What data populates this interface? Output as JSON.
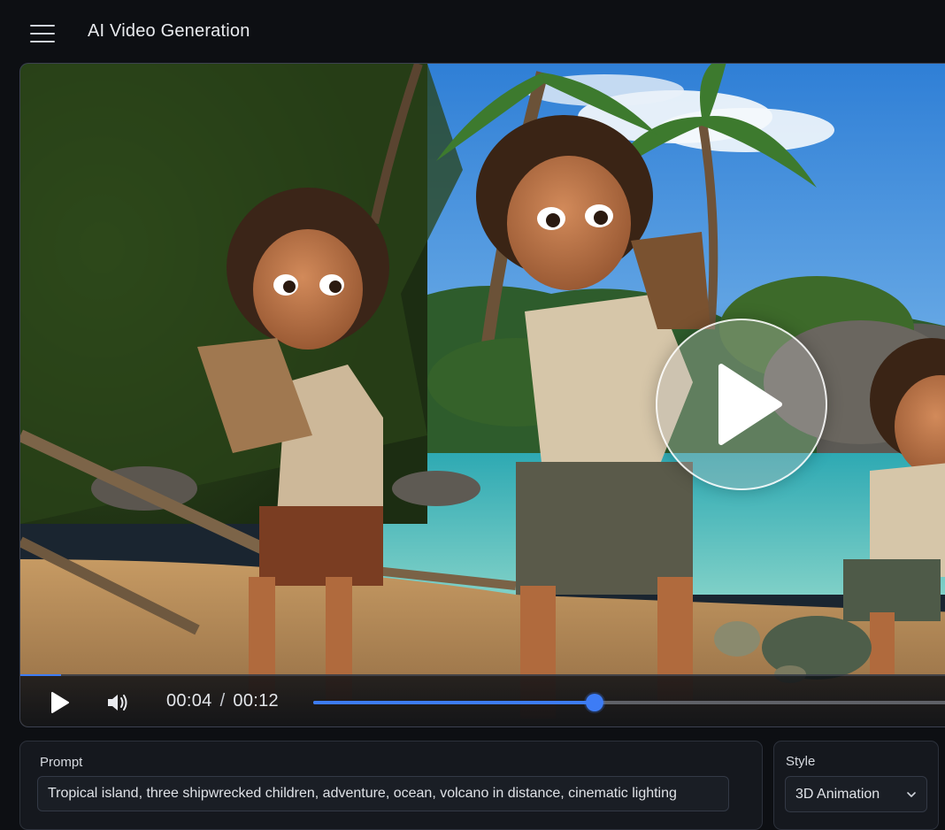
{
  "header": {
    "menu_icon": "hamburger-menu-icon",
    "title": "AI Video Generation"
  },
  "player": {
    "overlay_icon": "play-icon",
    "play_icon": "play-icon",
    "volume_icon": "volume-icon",
    "current_time": "00:04",
    "time_separator": "/",
    "duration": "00:12",
    "progress_fraction": 0.436,
    "accent_color": "#3d7cf5"
  },
  "prompt": {
    "label": "Prompt",
    "value": "Tropical island, three shipwrecked children, adventure, ocean, volcano in distance, cinematic lighting"
  },
  "style": {
    "label": "Style",
    "selected": "3D Animation",
    "dropdown_icon": "chevron-down-icon"
  }
}
